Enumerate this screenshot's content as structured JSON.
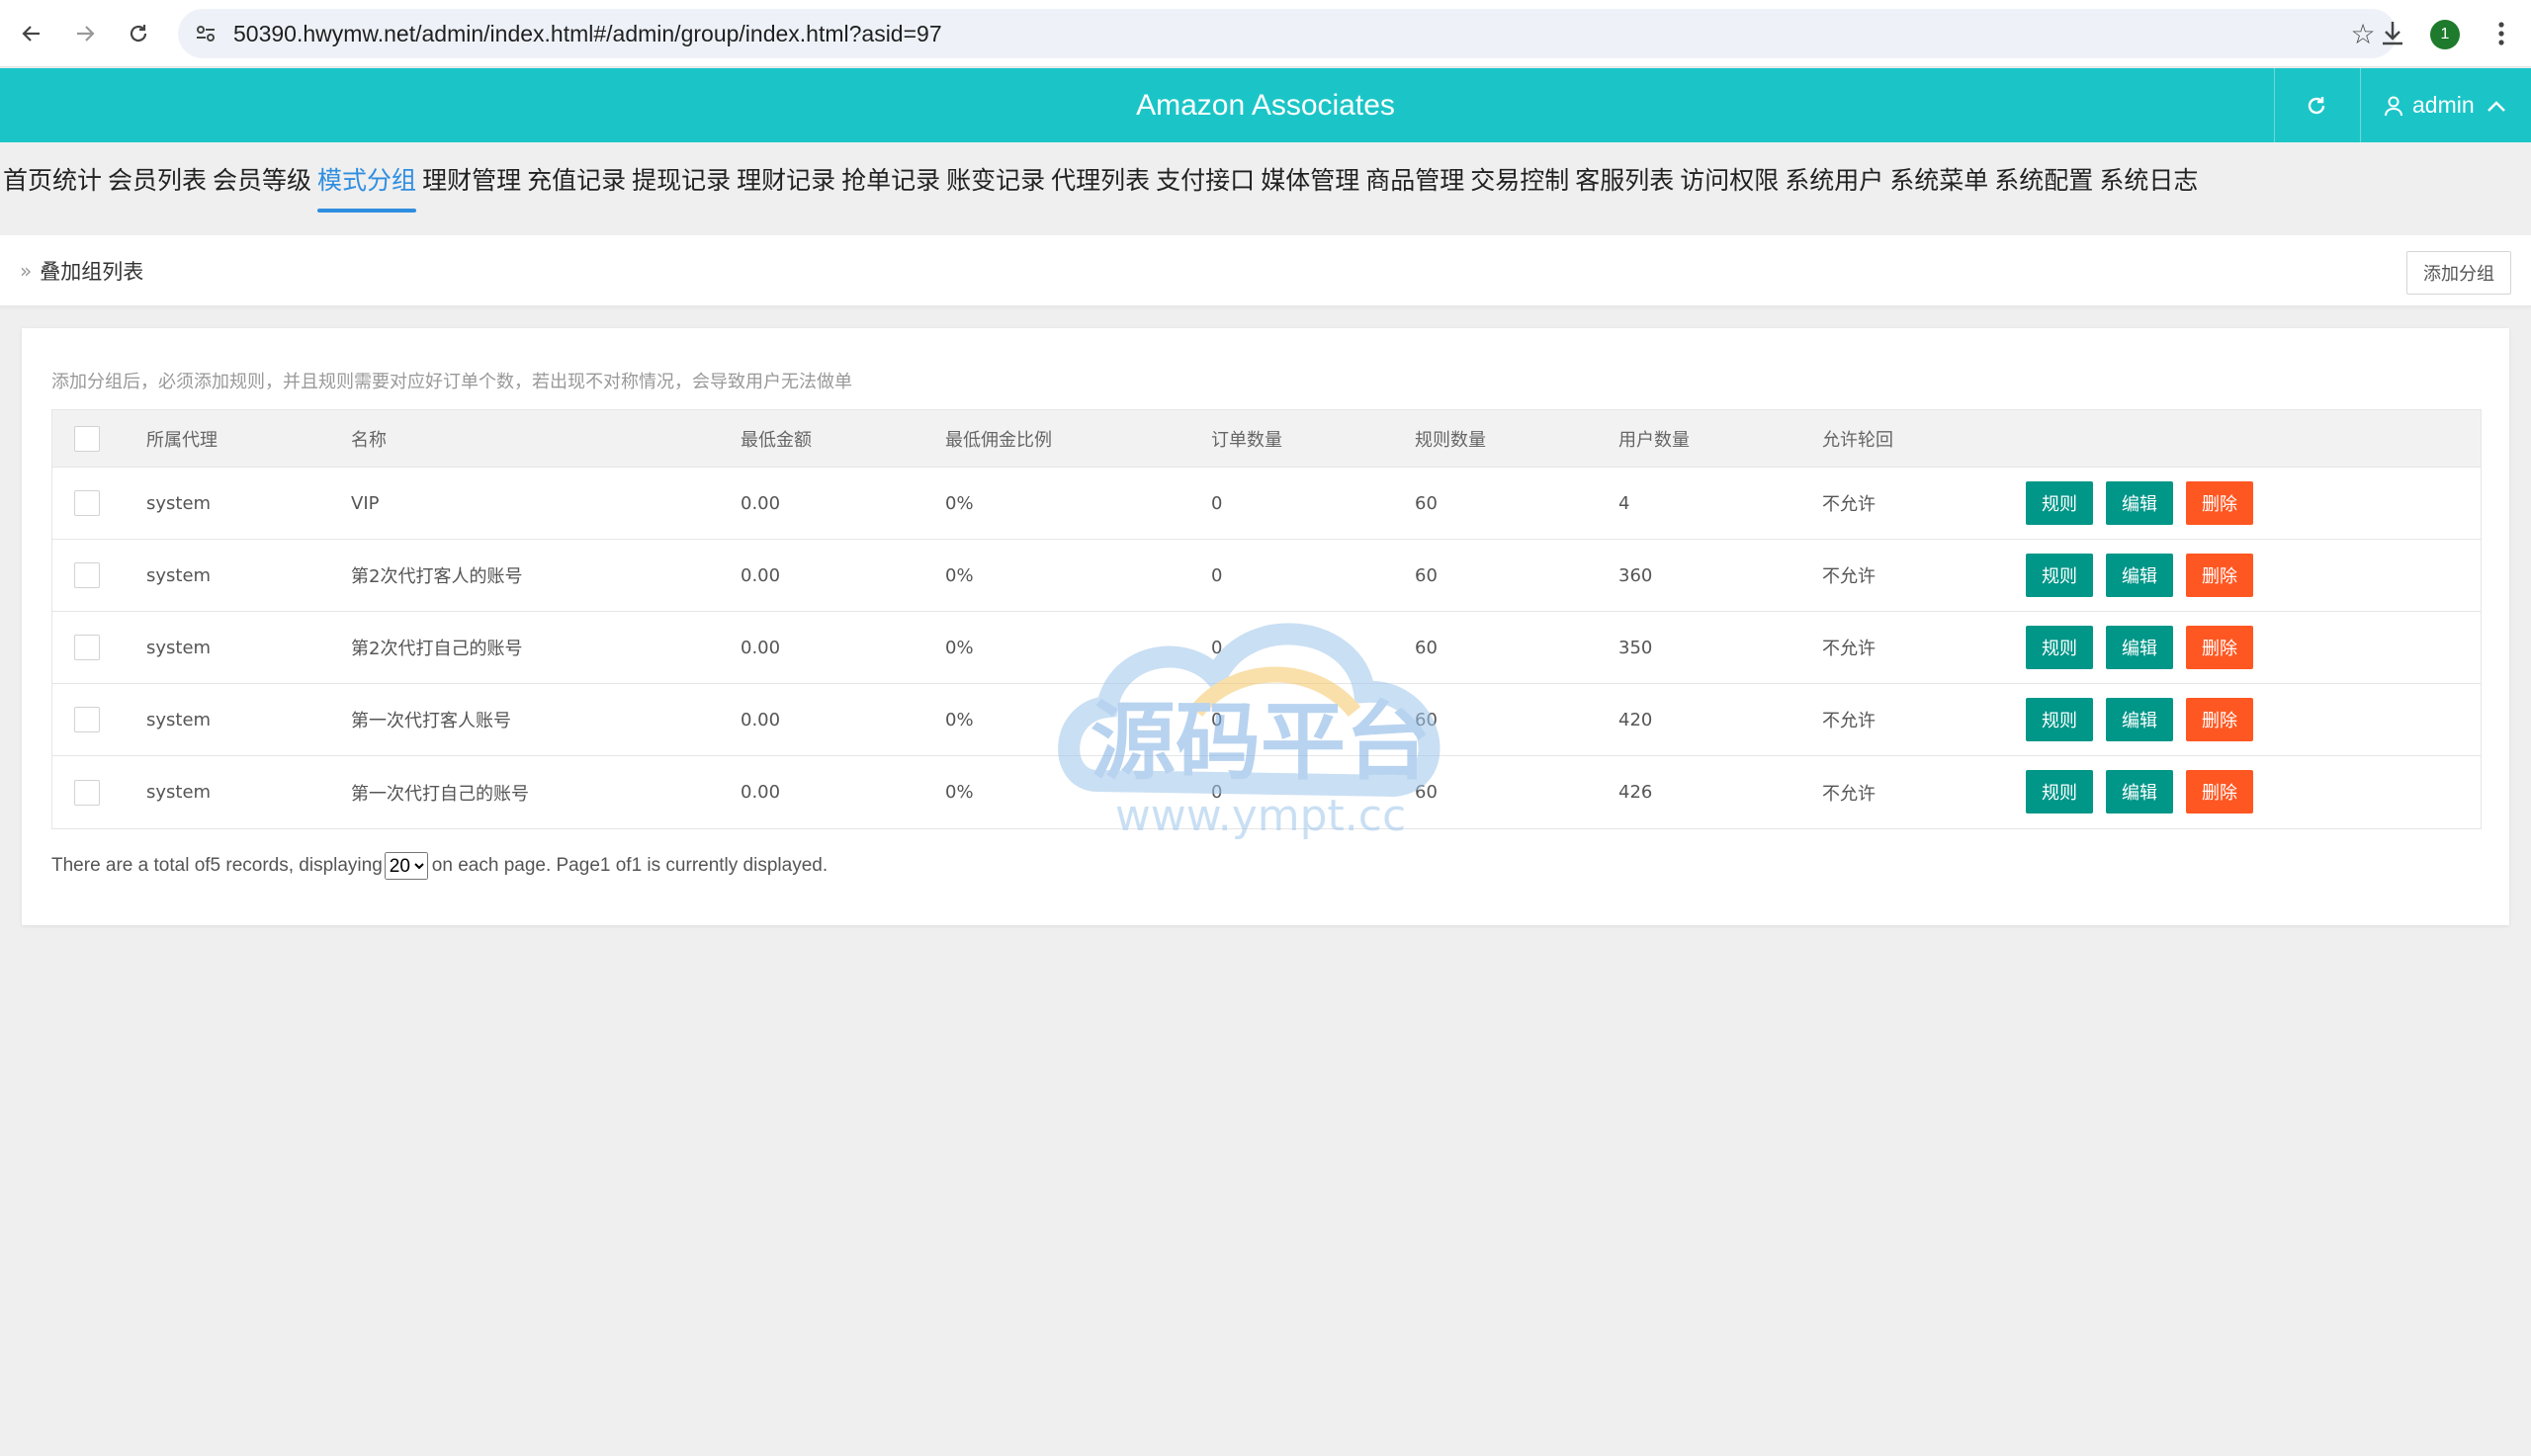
{
  "browser": {
    "url": "50390.hwymw.net/admin/index.html#/admin/group/index.html?asid=97",
    "profile_badge": "1"
  },
  "header": {
    "title": "Amazon Associates",
    "user": "admin"
  },
  "menu": [
    {
      "label": "首页统计"
    },
    {
      "label": "会员列表"
    },
    {
      "label": "会员等级"
    },
    {
      "label": "模式分组",
      "active": true
    },
    {
      "label": "理财管理"
    },
    {
      "label": "充值记录"
    },
    {
      "label": "提现记录"
    },
    {
      "label": "理财记录"
    },
    {
      "label": "抢单记录"
    },
    {
      "label": "账变记录"
    },
    {
      "label": "代理列表"
    },
    {
      "label": "支付接口"
    },
    {
      "label": "媒体管理"
    },
    {
      "label": "商品管理"
    },
    {
      "label": "交易控制"
    },
    {
      "label": "客服列表"
    },
    {
      "label": "访问权限"
    },
    {
      "label": "系统用户"
    },
    {
      "label": "系统菜单"
    },
    {
      "label": "系统配置"
    },
    {
      "label": "系统日志"
    }
  ],
  "breadcrumb": {
    "title": "叠加组列表",
    "add_button": "添加分组"
  },
  "tip": "添加分组后，必须添加规则，并且规则需要对应好订单个数，若出现不对称情况，会导致用户无法做单",
  "table": {
    "headers": [
      "所属代理",
      "名称",
      "最低金额",
      "最低佣金比例",
      "订单数量",
      "规则数量",
      "用户数量",
      "允许轮回"
    ],
    "rows": [
      {
        "agent": "system",
        "name": "VIP",
        "min_amount": "0.00",
        "min_rate": "0%",
        "orders": "0",
        "rules": "60",
        "users": "4",
        "cycle": "不允许"
      },
      {
        "agent": "system",
        "name": "第2次代打客人的账号",
        "min_amount": "0.00",
        "min_rate": "0%",
        "orders": "0",
        "rules": "60",
        "users": "360",
        "cycle": "不允许"
      },
      {
        "agent": "system",
        "name": "第2次代打自己的账号",
        "min_amount": "0.00",
        "min_rate": "0%",
        "orders": "0",
        "rules": "60",
        "users": "350",
        "cycle": "不允许"
      },
      {
        "agent": "system",
        "name": "第一次代打客人账号",
        "min_amount": "0.00",
        "min_rate": "0%",
        "orders": "0",
        "rules": "60",
        "users": "420",
        "cycle": "不允许"
      },
      {
        "agent": "system",
        "name": "第一次代打自己的账号",
        "min_amount": "0.00",
        "min_rate": "0%",
        "orders": "0",
        "rules": "60",
        "users": "426",
        "cycle": "不允许"
      }
    ],
    "actions": {
      "rule": "规则",
      "edit": "编辑",
      "delete": "删除"
    }
  },
  "pager": {
    "prefix": "There are a total of5 records, displaying",
    "page_size": "20",
    "suffix": "on each page. Page1 of1 is currently displayed."
  },
  "watermark": {
    "cn": "源码平台",
    "url": "www.ympt.cc"
  },
  "colors": {
    "header": "#1bc5c7",
    "active_menu": "#2f8ee0",
    "btn_green": "#009688",
    "btn_red": "#ff5722"
  }
}
